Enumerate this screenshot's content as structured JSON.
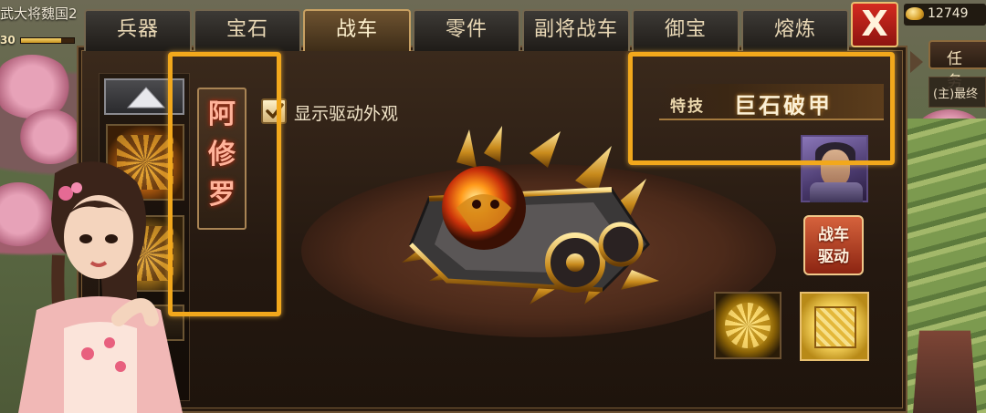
{
  "status": {
    "title_fragment": "武大将魏国2",
    "level_fragment": "30",
    "exp_progress": 0.75
  },
  "currency": {
    "gold_value": "12749",
    "gold_icon": "gold-ingot-icon"
  },
  "task_panel": {
    "tab_label": "任务",
    "line_fragment": "(主)最终"
  },
  "tabs": [
    {
      "label": "兵器",
      "active": false
    },
    {
      "label": "宝石",
      "active": false
    },
    {
      "label": "战车",
      "active": true
    },
    {
      "label": "零件",
      "active": false
    },
    {
      "label": "副将战车",
      "active": false
    },
    {
      "label": "御宝",
      "active": false
    },
    {
      "label": "熔炼",
      "active": false
    }
  ],
  "close_label": "X",
  "chariot": {
    "name": "阿修罗",
    "name_chars": [
      "阿",
      "修",
      "罗"
    ],
    "show_drive_label": "显示驱动外观",
    "show_drive_checked": true,
    "skill_label": "特技",
    "skill_name": "巨石破甲"
  },
  "actions": {
    "drive_line1": "战车",
    "drive_line2": "驱动"
  },
  "icons": {
    "up": "triangle-up-icon",
    "check": "checkmark-icon",
    "close": "close-icon"
  },
  "colors": {
    "highlight": "#f2a81c",
    "active_tab": "#6d5230",
    "close_red": "#d42a20",
    "drive_red": "#c24a2a"
  }
}
